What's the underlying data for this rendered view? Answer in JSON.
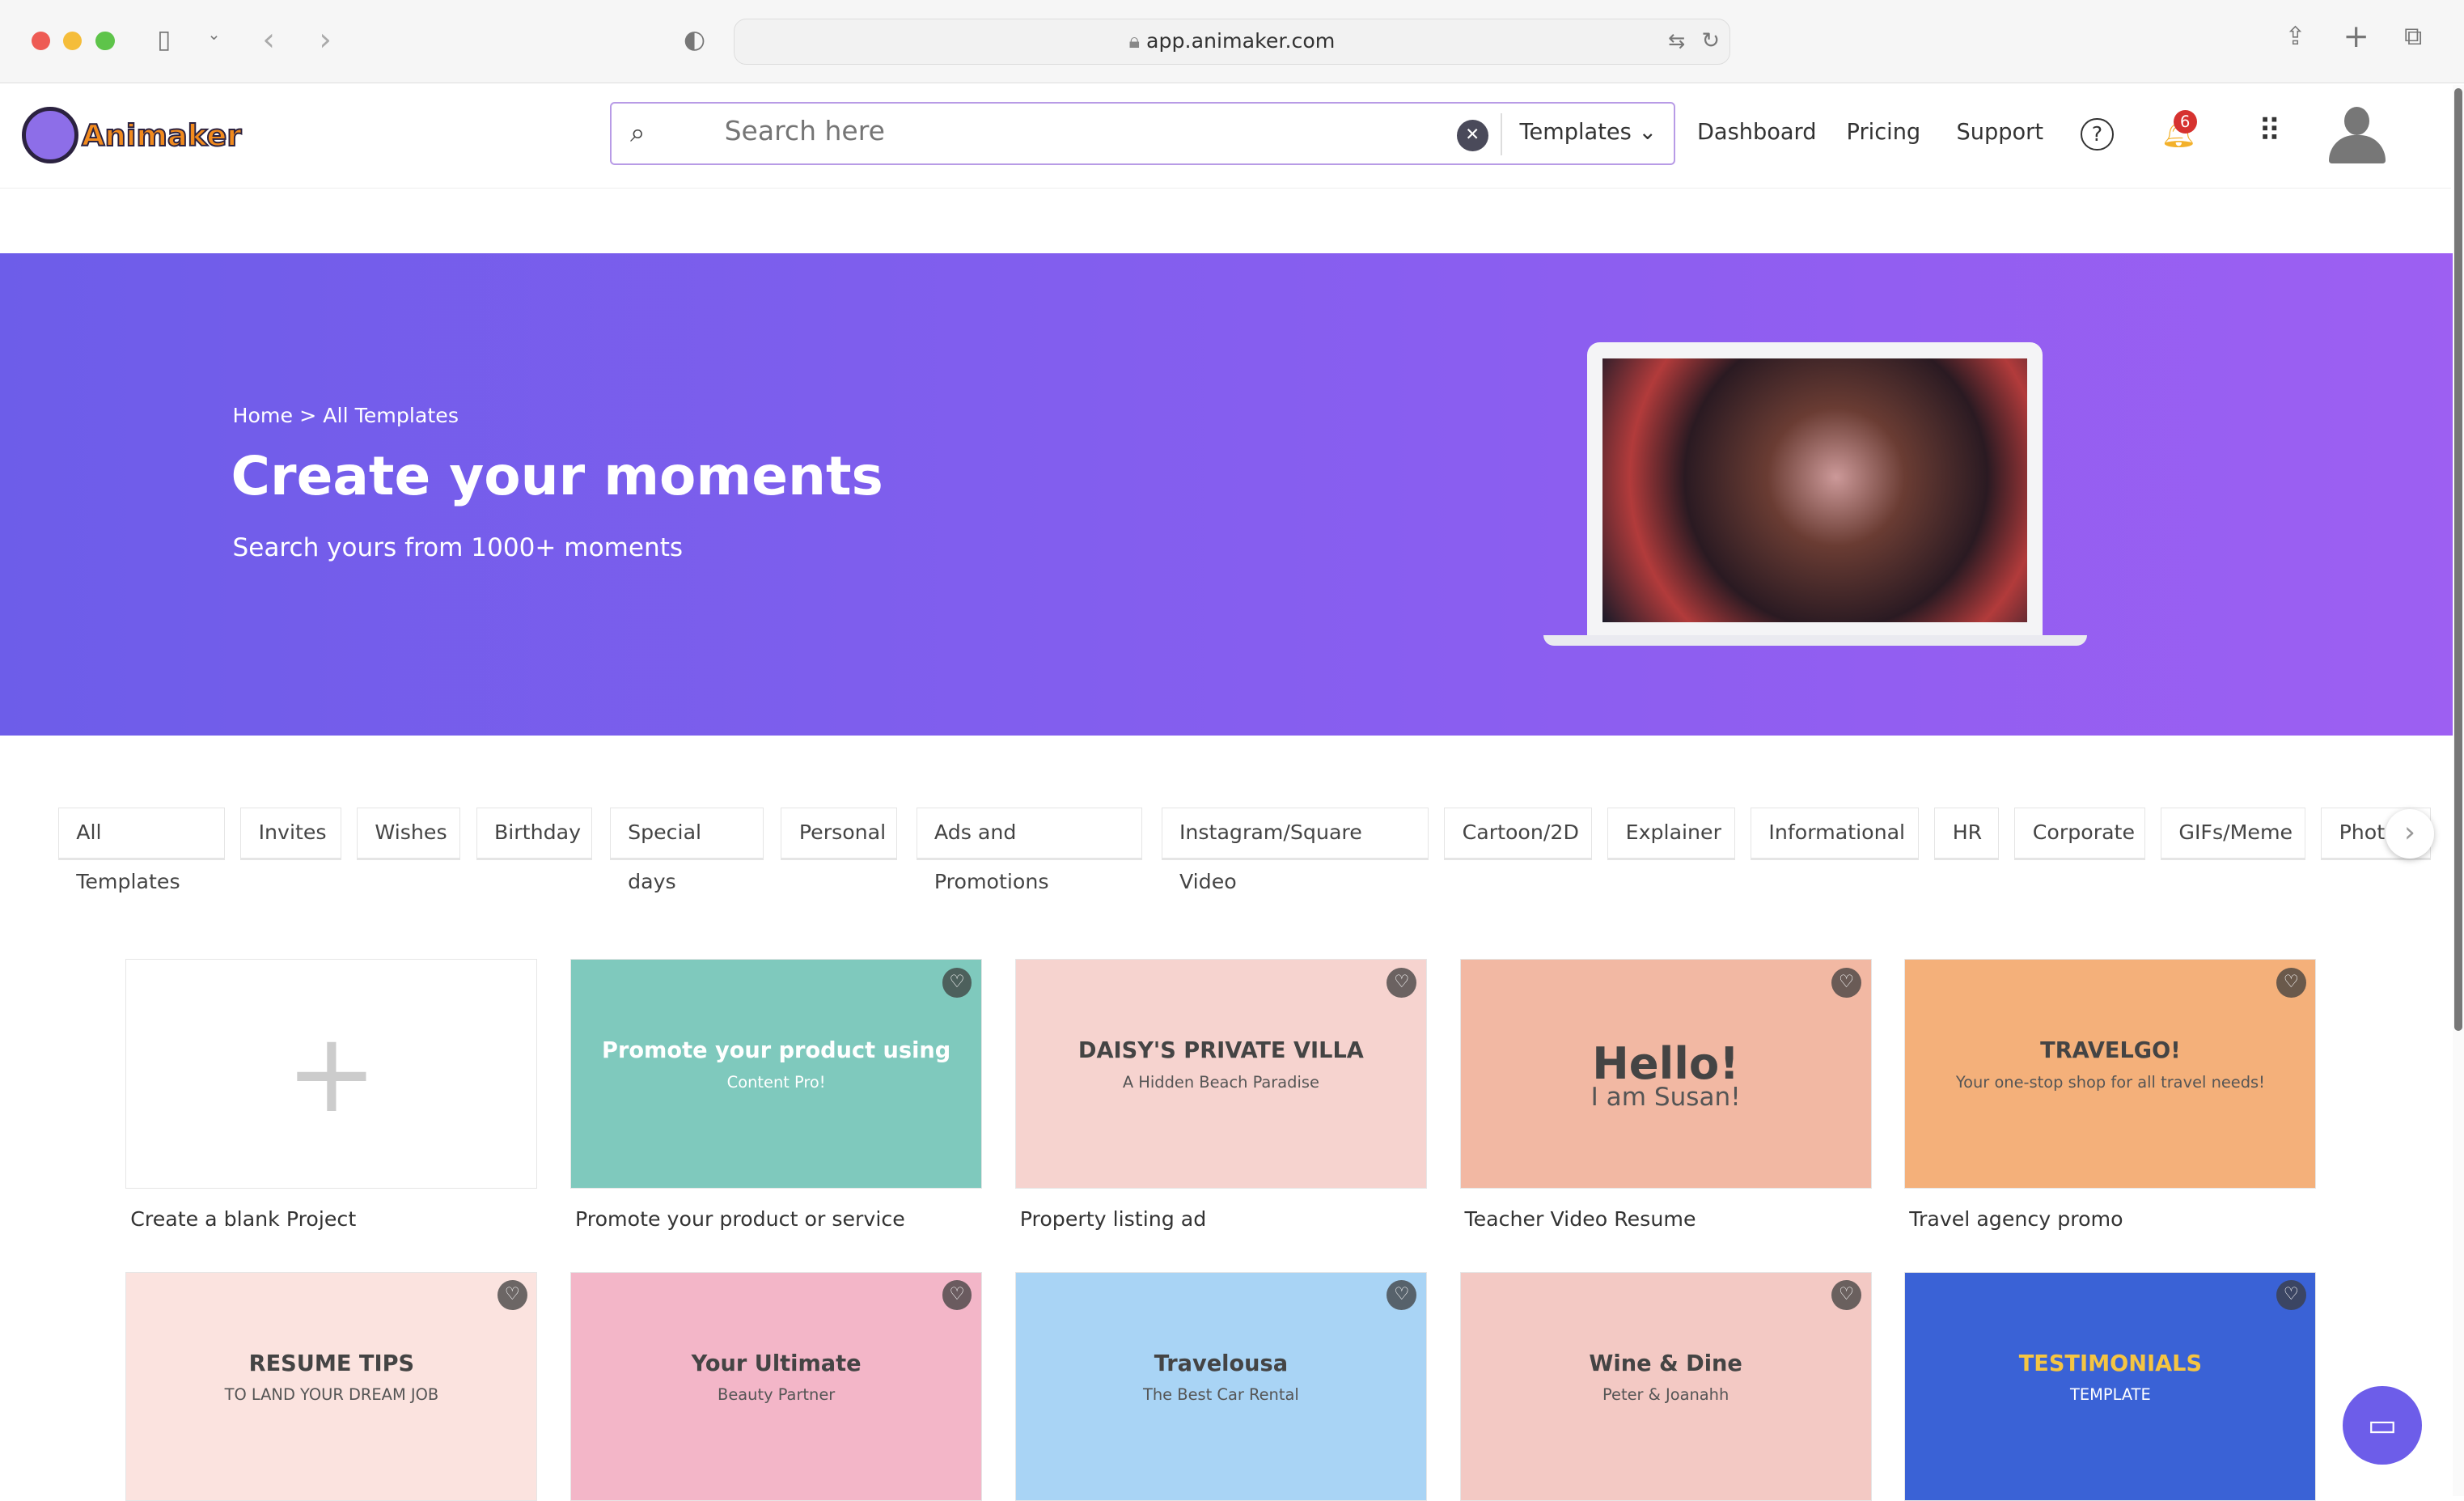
{
  "browser": {
    "url": "app.animaker.com"
  },
  "header": {
    "logo": "Animaker",
    "search_placeholder": "Search here",
    "search_scope": "Templates",
    "nav": [
      "Dashboard",
      "Pricing",
      "Support"
    ],
    "notification_count": "6"
  },
  "hero": {
    "breadcrumb": "Home > All Templates",
    "title": "Create your moments",
    "subtitle": "Search yours from 1000+ moments"
  },
  "categories": [
    "All Templates",
    "Invites",
    "Wishes",
    "Birthday",
    "Special days",
    "Personal",
    "Ads and Promotions",
    "Instagram/Square Video",
    "Cartoon/2D",
    "Explainer",
    "Informational",
    "HR",
    "Corporate",
    "GIFs/Meme",
    "Phot"
  ],
  "templates": [
    {
      "label": "Create a blank Project"
    },
    {
      "label": "Promote your product or service",
      "thumb": "Promote your product using",
      "thumb2": "Content Pro!",
      "color": "#7fc9bd"
    },
    {
      "label": "Property listing ad",
      "thumb": "DAISY'S PRIVATE VILLA",
      "thumb2": "A Hidden Beach Paradise",
      "color": "#f6d3cf"
    },
    {
      "label": "Teacher Video Resume",
      "thumb": "Hello!",
      "thumb2": "I am Susan!",
      "color": "#f2b8a3"
    },
    {
      "label": "Travel agency promo",
      "thumb": "TRAVELGO!",
      "thumb2": "Your one-stop shop for all travel needs!",
      "color": "#f4b07a"
    },
    {
      "thumb": "RESUME TIPS",
      "thumb2": "TO LAND YOUR DREAM JOB",
      "color": "#fbe3df"
    },
    {
      "thumb": "Your Ultimate",
      "thumb2": "Beauty Partner",
      "color": "#f3b6c8"
    },
    {
      "thumb": "Travelousa",
      "thumb2": "The Best Car Rental",
      "color": "#a9d4f5"
    },
    {
      "thumb": "Wine & Dine",
      "thumb2": "Peter & Joanahh",
      "color": "#f3c9c4"
    },
    {
      "thumb": "TESTIMONIALS",
      "thumb2": "TEMPLATE",
      "color": "#3a62d6"
    }
  ]
}
